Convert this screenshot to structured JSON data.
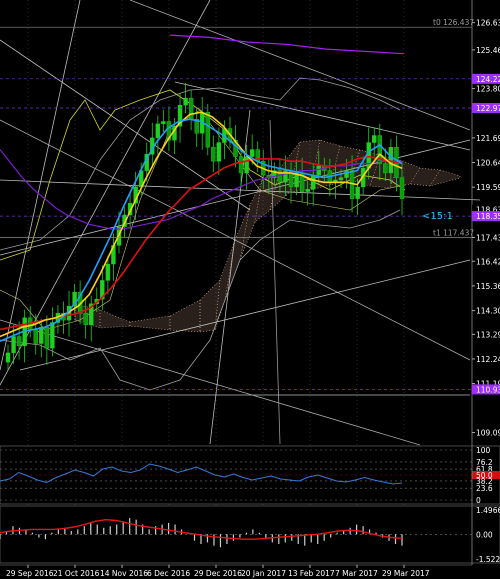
{
  "chart_data": {
    "type": "line",
    "price_axis": {
      "ylim": [
        108.6,
        127.6
      ],
      "ticks": [
        "126.631",
        "125.464",
        "124.227",
        "123.809",
        "122.979",
        "121.699",
        "120.644",
        "119.590",
        "118.631",
        "117.437",
        "116.420",
        "115.367",
        "114.308",
        "113.290",
        "112.240",
        "111.190",
        "110.936",
        "109.090"
      ]
    },
    "x": [
      "29 Sep 2016",
      "21 Oct 2016",
      "14 Nov 2016",
      "6 Dec 2016",
      "29 Dec 2016",
      "20 Jan 2017",
      "13 Feb 2017",
      "7 Mar 2017",
      "29 Mar 2017"
    ],
    "levels": [
      {
        "label": "t0 126.437",
        "value": 126.437,
        "color": "#8c8c8c"
      },
      {
        "label": "t1 117.437",
        "value": 117.437,
        "color": "#8c8c8c"
      }
    ],
    "price_tags": [
      {
        "text": "124.227",
        "value": 124.227,
        "color": "#9b30ff"
      },
      {
        "text": "122.979",
        "value": 122.979,
        "color": "#9b30ff"
      },
      {
        "text": "118.631",
        "value": 118.631,
        "color": "#ffffff"
      },
      {
        "text": "118.351",
        "value": 118.351,
        "color": "#9b30ff"
      },
      {
        "text": "110.936",
        "value": 110.936,
        "color": "#9b30ff"
      }
    ],
    "countdown": "<15:1",
    "close": [
      112.5,
      113.2,
      112.8,
      114.0,
      113.5,
      112.9,
      113.6,
      112.7,
      113.8,
      114.2,
      113.9,
      114.5,
      115.1,
      114.2,
      113.7,
      114.6,
      114.8,
      115.6,
      116.3,
      117.1,
      117.9,
      118.4,
      118.9,
      119.6,
      120.3,
      121.0,
      121.7,
      122.3,
      122.4,
      121.6,
      122.2,
      123.1,
      123.4,
      122.5,
      121.9,
      122.8,
      121.3,
      120.7,
      121.5,
      122.1,
      121.6,
      120.9,
      120.2,
      120.9,
      121.2,
      120.7,
      120.1,
      120.0,
      120.3,
      119.8,
      120.3,
      119.6,
      120.2,
      119.4,
      119.5,
      120.1,
      120.5,
      120.3,
      119.8,
      119.9,
      120.0,
      120.3,
      119.1,
      119.6,
      120.4,
      121.5,
      121.8,
      120.6,
      120.2,
      121.3,
      120.0,
      119.1
    ],
    "ma_yellow": [
      113.2,
      113.4,
      113.6,
      113.7,
      113.9,
      114.0,
      114.2,
      114.5,
      115.0,
      115.9,
      116.9,
      117.9,
      118.9,
      119.9,
      120.8,
      121.6,
      122.3,
      122.7,
      122.8,
      122.6,
      122.2,
      121.6,
      121.0,
      120.5,
      120.3,
      120.2,
      120.2,
      120.1,
      119.9,
      119.8,
      119.8,
      119.8,
      119.7,
      120.4,
      121.0,
      120.6,
      120.4
    ],
    "ma_cyan": [
      113.0,
      113.2,
      113.4,
      113.5,
      113.6,
      113.8,
      114.2,
      114.8,
      115.6,
      116.6,
      117.6,
      118.7,
      119.7,
      120.7,
      121.5,
      122.1,
      122.4,
      122.5,
      122.4,
      122.1,
      121.8,
      121.4,
      121.0,
      120.7,
      120.5,
      120.4,
      120.3,
      120.2,
      120.1,
      120.0,
      120.1,
      120.2,
      120.3,
      121.1,
      121.4,
      120.9,
      120.6
    ],
    "ma_red": [
      113.5,
      113.6,
      113.7,
      113.8,
      113.9,
      114.0,
      114.1,
      114.2,
      114.4,
      114.8,
      115.3,
      115.9,
      116.6,
      117.3,
      117.9,
      118.5,
      119.0,
      119.5,
      119.8,
      120.1,
      120.4,
      120.6,
      120.7,
      120.8,
      120.8,
      120.8,
      120.7,
      120.7,
      120.6,
      120.5,
      120.5,
      120.6,
      120.8,
      120.9,
      120.8,
      120.7,
      120.6
    ],
    "ma_purple": [
      121.2,
      120.6,
      120.0,
      119.5,
      119.1,
      118.7,
      118.4,
      118.2,
      118.0,
      117.9,
      117.8,
      117.8,
      117.9,
      118.0,
      118.1,
      118.2,
      118.4,
      118.6,
      118.8,
      119.1,
      119.3,
      119.5,
      119.7,
      119.9,
      120.0,
      120.1,
      120.2,
      120.3,
      120.3,
      120.4,
      120.5,
      120.5,
      120.6,
      120.6,
      120.7,
      120.7,
      120.7
    ],
    "ma_slow_purple": [
      126.1,
      126.0,
      125.8,
      125.7,
      125.5,
      125.4,
      125.3
    ],
    "stoch": {
      "levels": [
        100,
        76.2,
        61.8,
        50,
        38.2,
        23.6,
        0
      ],
      "labels": [
        "100",
        "76.2",
        "61.8",
        "50.0",
        "38.2",
        "23.6",
        "0"
      ],
      "values": [
        38,
        42,
        55,
        48,
        40,
        35,
        45,
        52,
        60,
        55,
        48,
        62,
        66,
        58,
        55,
        60,
        72,
        68,
        62,
        55,
        60,
        66,
        58,
        50,
        46,
        52,
        45,
        40,
        44,
        48,
        42,
        40,
        38,
        46,
        50,
        44,
        38,
        36,
        40,
        45,
        40,
        36,
        32,
        34
      ]
    },
    "osc": {
      "labels": [
        "1.4966",
        "0.00",
        "-1.5221"
      ],
      "ylim": [
        -1.5221,
        1.4966
      ],
      "hist": [
        -0.3,
        0.2,
        0.5,
        0.4,
        0.3,
        0.1,
        -0.2,
        -0.3,
        0.1,
        0.3,
        0.4,
        0.2,
        0.3,
        0.5,
        0.7,
        0.6,
        0.4,
        0.5,
        0.6,
        0.8,
        1.0,
        0.9,
        0.6,
        0.3,
        0.5,
        0.6,
        0.7,
        0.6,
        0.3,
        0.0,
        -0.4,
        -0.6,
        -0.5,
        -0.7,
        -0.8,
        -0.6,
        -0.4,
        -0.2,
        0.1,
        0.3,
        0.1,
        -0.3,
        -0.5,
        -0.6,
        -0.5,
        -0.4,
        -0.6,
        -0.7,
        -0.5,
        -0.6,
        -0.4,
        -0.2,
        0.1,
        0.2,
        0.4,
        0.6,
        0.5,
        0.3,
        0.1,
        -0.2,
        -0.4,
        -0.6,
        -0.7
      ],
      "signal": [
        0.1,
        0.2,
        0.25,
        0.3,
        0.3,
        0.3,
        0.35,
        0.45,
        0.6,
        0.8,
        0.9,
        0.85,
        0.7,
        0.55,
        0.45,
        0.35,
        0.25,
        0.15,
        0.05,
        -0.05,
        -0.15,
        -0.2,
        -0.25,
        -0.3,
        -0.3,
        -0.25,
        -0.2,
        -0.15,
        -0.1,
        -0.05,
        0.0,
        0.1,
        0.2,
        0.25,
        0.2,
        0.05,
        -0.1,
        -0.2,
        -0.25
      ]
    }
  }
}
